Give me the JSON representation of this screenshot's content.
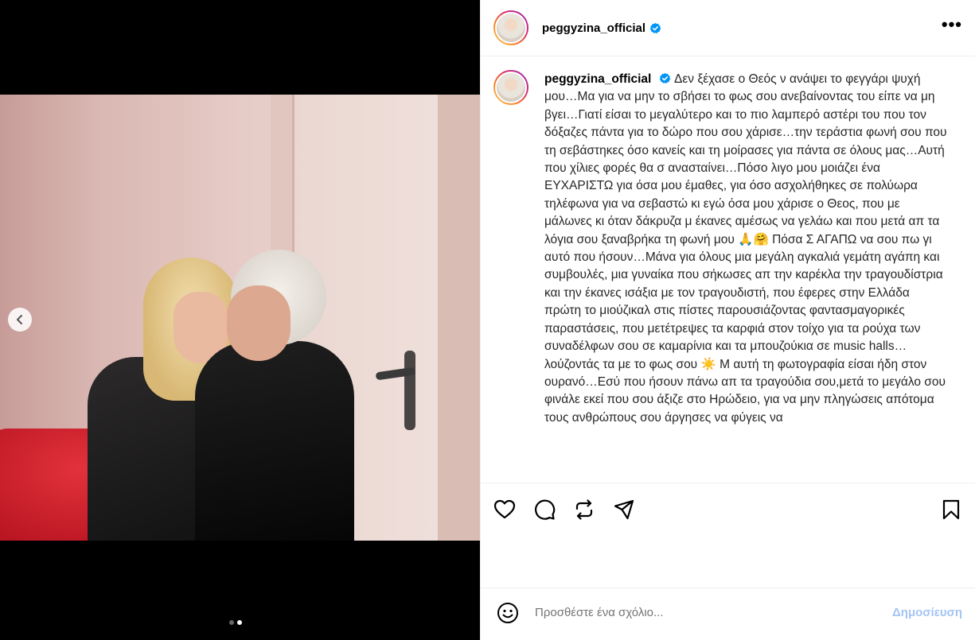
{
  "post": {
    "username": "peggyzina_official",
    "more_label": "•••",
    "caption_lines": [
      "Δεν ξέχασε ο Θεός ν ανάψει το φεγγάρι",
      "ψυχή μου…Μα για να μην το σβήσει το φως σου ανεβαίνοντας",
      "του είπε να μη βγει…Γιατί είσαι το μεγαλύτερο και το πιο",
      "λαμπερό αστέρι του που τον δόξαζες πάντα για το δώρο που",
      "σου χάρισε…την τεράστια φωνή σου που τη σεβάστηκες όσο",
      "κανείς και τη μοίρασες για πάντα σε όλους μας…Αυτή που",
      "χίλιες φορές θα σ ανασταίνει…Πόσο λιγο μου μοιάζει ένα",
      "ΕΥΧΑΡΙΣΤΩ για όσα μου έμαθες, για όσο ασχολήθηκες σε",
      "πολύωρα τηλέφωνα για να σεβαστώ κι εγώ όσα μου χάρισε ο",
      "Θεος, που με μάλωνες κι όταν δάκρυζα μ έκανες αμέσως να",
      "γελάω και που μετά απ τα λόγια σου ξαναβρήκα τη φωνή μου",
      "Πόσα Σ ΑΓΑΠΩ να σου πω γι αυτό που ήσουν…Μάνα για",
      "όλους μια μεγάλη αγκαλιά γεμάτη αγάπη και συμβουλές, μια",
      "γυναίκα που σήκωσες απ την καρέκλα την τραγουδίστρια και",
      "την έκανες ισάξια με τον τραγουδιστή, που έφερες στην",
      "Ελλάδα πρώτη το μιούζικαλ στις πίστες παρουσιάζοντας",
      "φαντασμαγορικές παραστάσεις, που μετέτρεψες τα καρφιά",
      "στον τοίχο για τα ρούχα των συναδέλφων σου σε καμαρίνια",
      "και τα μπουζούκια σε music halls…λούζοντάς τα με το φως σου",
      "Μ αυτή τη φωτογραφία είσαι ήδη στον ουρανό…Εσύ που",
      "ήσουν πάνω απ τα τραγούδια σου,μετά το μεγάλο σου φινάλε",
      "εκεί που σου άξιζε στο Ηρώδειο, για να μην πληγώσεις",
      "απότομα τους ανθρώπους σου άργησες να φύγεις να"
    ],
    "emojis": {
      "pray": "🙏",
      "hug": "🤗",
      "sun": "☀️"
    },
    "carousel": {
      "total": 2,
      "active": 2
    }
  },
  "comment": {
    "placeholder": "Προσθέστε ένα σχόλιο...",
    "post_label": "Δημοσίευση"
  },
  "icons": {
    "prev": "chevron-left-icon",
    "like": "heart-icon",
    "comment": "comment-icon",
    "repost": "repost-icon",
    "share": "share-icon",
    "save": "bookmark-icon",
    "emoji": "smiley-icon",
    "verified": "verified-badge-icon"
  },
  "colors": {
    "verified": "#0095f6",
    "post_button_disabled": "#a4c4f5",
    "story_ring": [
      "#feda75",
      "#fa7e1e",
      "#d62976",
      "#962fbf"
    ]
  }
}
